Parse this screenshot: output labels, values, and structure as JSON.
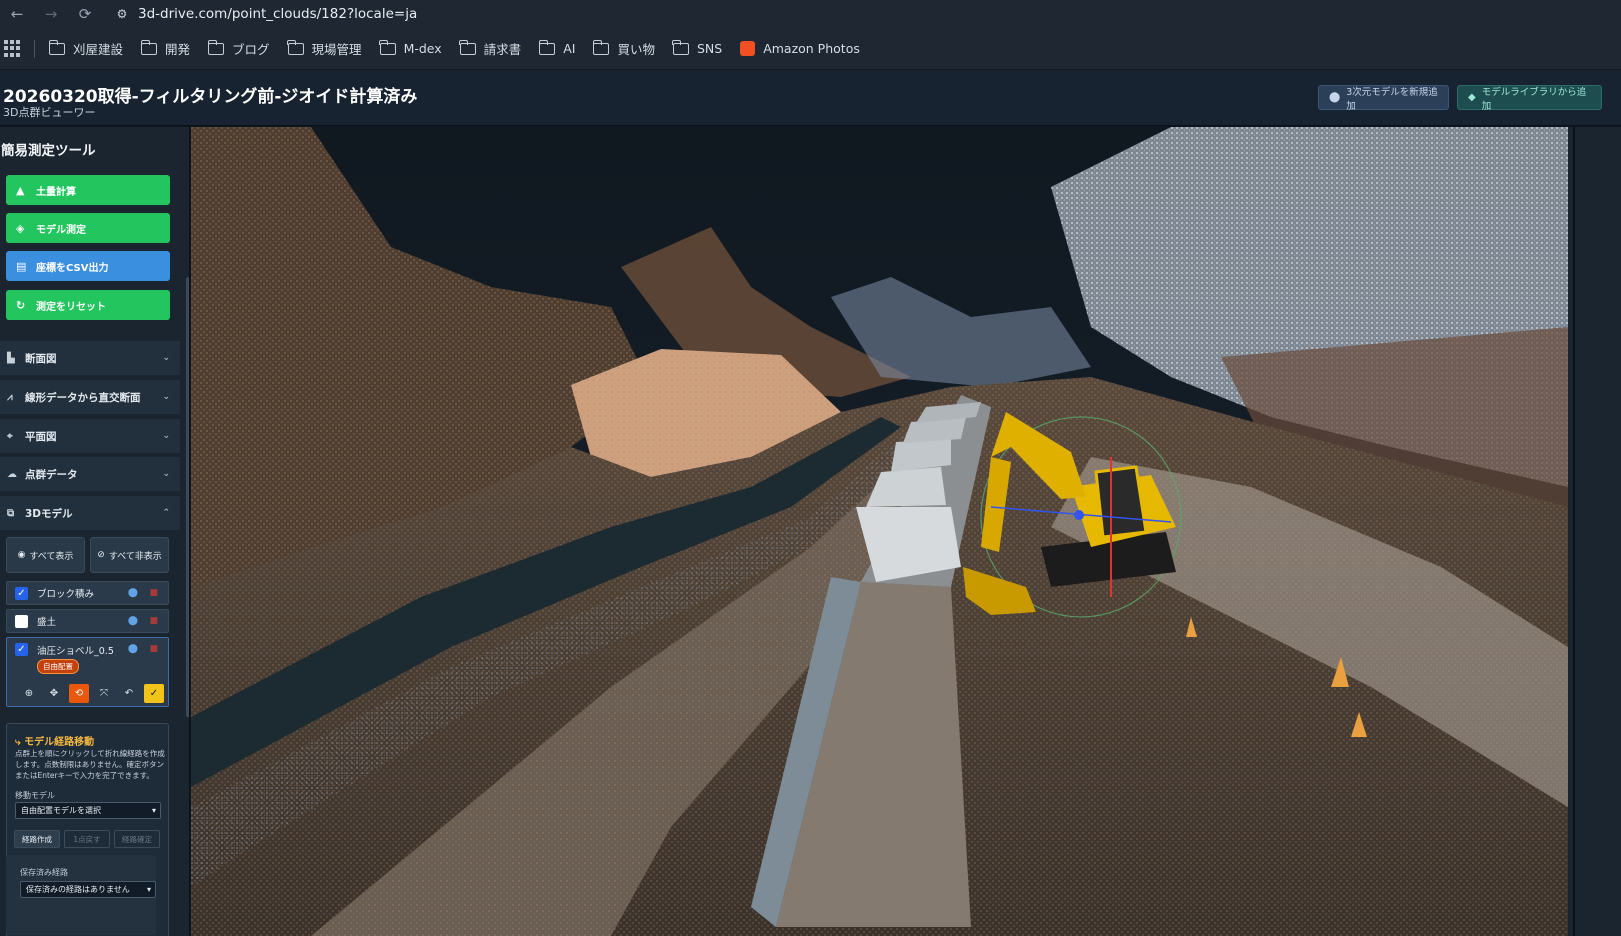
{
  "browser": {
    "url": "3d-drive.com/point_clouds/182?locale=ja",
    "bookmarks": [
      "刈屋建設",
      "開発",
      "ブログ",
      "現場管理",
      "M-dex",
      "請求書",
      "AI",
      "買い物",
      "SNS"
    ],
    "amazon": "Amazon Photos"
  },
  "header": {
    "title": "20260320取得-フィルタリング前-ジオイド計算済み",
    "subtitle": "3D点群ビューワー",
    "add_model_button": "3次元モデルを新規追加",
    "library_button": "モデルライブラリから追加"
  },
  "sidebar": {
    "title": "簡易測定ツール",
    "buttons": {
      "earthwork": "土量計算",
      "model_measure": "モデル測定",
      "csv": "座標をCSV出力",
      "reset": "測定をリセット"
    },
    "sections": {
      "cross": "断面図",
      "alignment": "線形データから直交断面",
      "plan": "平面図",
      "pointcloud": "点群データ",
      "models": "3Dモデル"
    },
    "show_all": "すべて表示",
    "hide_all": "すべて非表示",
    "models": [
      {
        "name": "ブロック積み",
        "checked": true
      },
      {
        "name": "盛土",
        "checked": false
      },
      {
        "name": "油圧ショベル_0.5",
        "checked": true,
        "badge": "自由配置"
      }
    ],
    "route": {
      "title": "モデル経路移動",
      "description": "点群上を順にクリックして折れ線経路を作成します。点数制限はありません。確定ボタンまたはEnterキーで入力を完了できます。",
      "move_model_label": "移動モデル",
      "move_model_value": "自由配置モデルを選択",
      "create_button": "経路作成",
      "undo_button": "1点戻す",
      "confirm_button": "経路確定",
      "saved_label": "保存済み経路",
      "saved_value": "保存済みの経路はありません"
    }
  },
  "colors": {
    "green": "#22c55e",
    "blue": "#3b8fdf",
    "header_bg": "#172330",
    "sidebar_bg": "#1a2530",
    "accent_orange": "#ea580c",
    "excavator_yellow": "#e6b800"
  }
}
